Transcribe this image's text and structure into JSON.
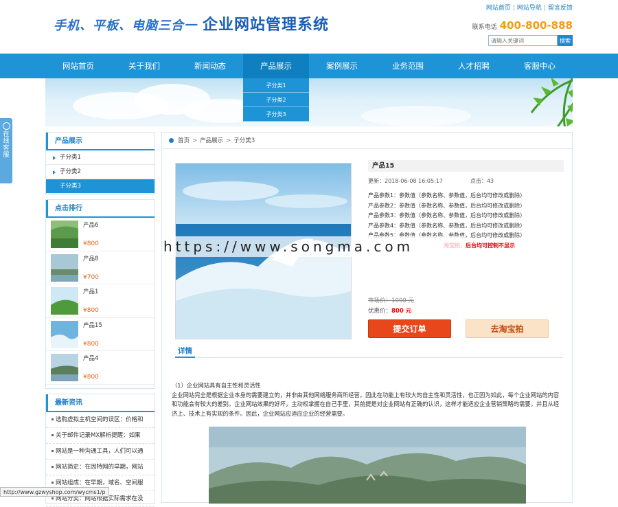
{
  "header": {
    "slogan": "手机、平板、电脑三合一",
    "site_name": "企业网站管理系统",
    "toplinks": [
      "网站首页",
      "网站导航",
      "留言反馈"
    ],
    "phone_label": "联系电话",
    "phone": "400-800-888",
    "search_placeholder": "请输入关键词",
    "search_button": "搜索"
  },
  "nav": {
    "items": [
      "网站首页",
      "关于我们",
      "新闻动态",
      "产品展示",
      "案例展示",
      "业务范围",
      "人才招聘",
      "客服中心"
    ],
    "active_index": 3,
    "dropdown": [
      "子分类1",
      "子分类2",
      "子分类3"
    ]
  },
  "service_tab": "在线客服",
  "sidebar": {
    "products_title": "产品展示",
    "categories": [
      "子分类1",
      "子分类2",
      "子分类3"
    ],
    "active_category": 2,
    "ranking_title": "点击排行",
    "ranking": [
      {
        "name": "产品6",
        "price": "¥800"
      },
      {
        "name": "产品8",
        "price": "¥700"
      },
      {
        "name": "产品1",
        "price": "¥800"
      },
      {
        "name": "产品15",
        "price": "¥800"
      },
      {
        "name": "产品4",
        "price": "¥800"
      }
    ],
    "news_title": "最新资讯",
    "news": [
      "选购虚拟主机空间的误区：价格和",
      "关于邮件记录MX解析提醒：如果",
      "网站是一种沟通工具，人们可以通",
      "网站简史：在因特网的早期，网站",
      "网站组成：在早期，域名、空间服",
      "网站分类：网站根据实际需求在没"
    ]
  },
  "breadcrumb": [
    "首页",
    "产品展示",
    "子分类3"
  ],
  "product": {
    "title": "产品15",
    "updated_label": "更新：",
    "updated": "2018-06-08 16:05:17",
    "hits_label": "点击：",
    "hits": "43",
    "params": [
      "产品参数1：参数值（参数名称、参数值，后台均可修改或删除）",
      "产品参数2：参数值（参数名称、参数值，后台均可修改或删除）",
      "产品参数3：参数值（参数名称、参数值，后台均可修改或删除）",
      "产品参数4：参数值（参数名称、参数值，后台均可修改或删除）",
      "产品参数5：参数值（参数名称、参数值，后台均可修改或删除）"
    ],
    "taobao_note": "淘宝拍，后台均可控制不显示",
    "market_price_label": "市场价：",
    "market_price": "1000 元",
    "sale_price_label": "优惠价：",
    "sale_price": "800 元",
    "order_button": "提交订单",
    "taobao_button": "去淘宝拍"
  },
  "detail": {
    "heading": "详情",
    "subtitle": "（1）企业网站具有自主性和灵活性",
    "body": "企业网站完全是根据企业本身的需要建立的，并非由其他网络服务商所经营，因此在功能上有较大的自主性和灵活性，也正因为如此，每个企业网站的内容和功能会有较大的差别。企业网站效果的好坏，主动权掌握在自己手里，其前提是对企业网站有正确的认识，这样才能适应企业营销策略的需要，并且从经济上、技术上有实现的条件。因此，企业网站应适应企业的经营需要。"
  },
  "watermark": "https://www.songma.com",
  "status_url": "http://www.gzwyshop.com/wycms1/p",
  "colors": {
    "primary": "#1e93d6",
    "accent": "#f39c12",
    "order": "#e8471c",
    "price": "#e2661a"
  }
}
